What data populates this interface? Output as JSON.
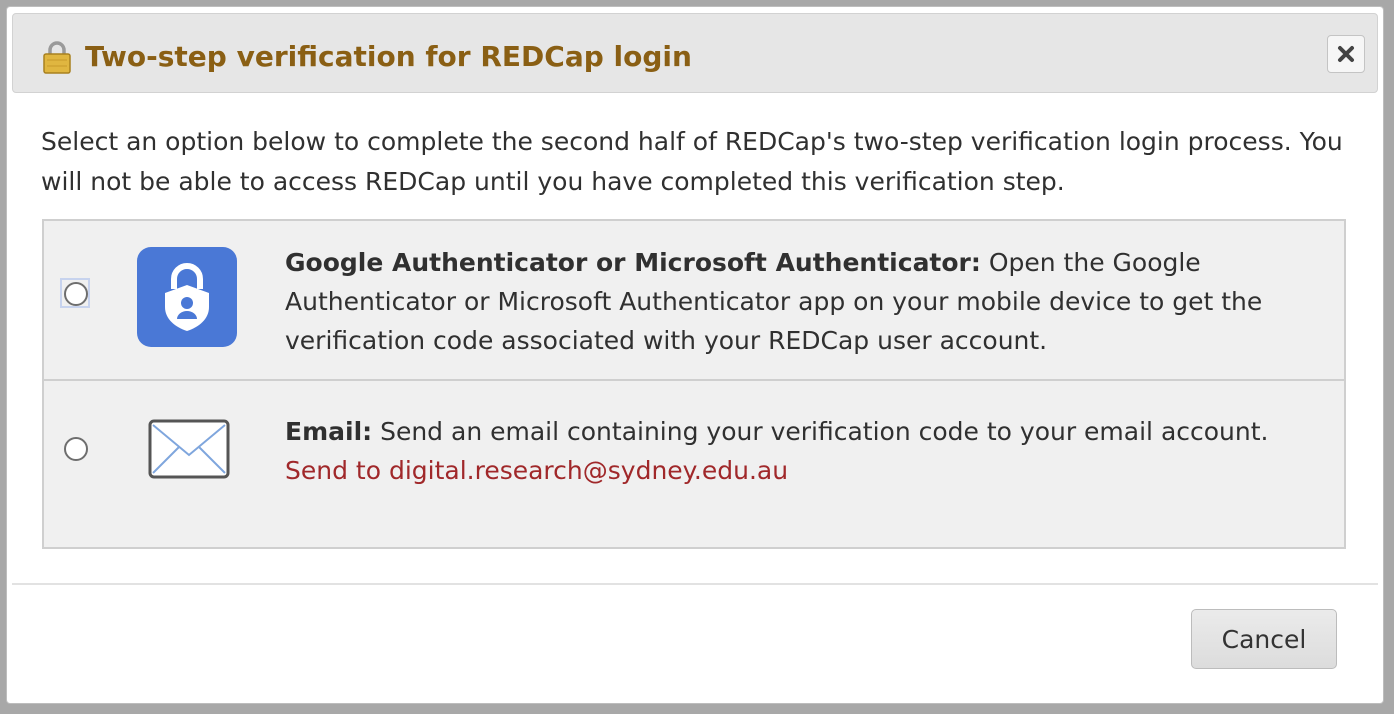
{
  "dialog": {
    "title": "Two-step verification for REDCap login",
    "title_icon": "lock-icon",
    "close_icon": "close-icon",
    "intro": "Select an option below to complete the second half of REDCap's two-step verification login process. You will not be able to access REDCap until you have completed this verification step."
  },
  "options": [
    {
      "icon": "authenticator-app-icon",
      "label": "Google Authenticator or Microsoft Authenticator:",
      "description": " Open the Google Authenticator or Microsoft Authenticator app on your mobile device to get the verification code associated with your REDCap user account.",
      "selected": false
    },
    {
      "icon": "email-envelope-icon",
      "label": "Email:",
      "description": " Send an email containing your verification code to your email account.",
      "send_to": "Send to digital.research@sydney.edu.au",
      "selected": false
    }
  ],
  "footer": {
    "cancel_label": "Cancel"
  },
  "colors": {
    "title": "#8a5f14",
    "send_to": "#a0282a",
    "auth_icon_bg": "#4a78d6",
    "option_bg": "#f0f0f0"
  }
}
